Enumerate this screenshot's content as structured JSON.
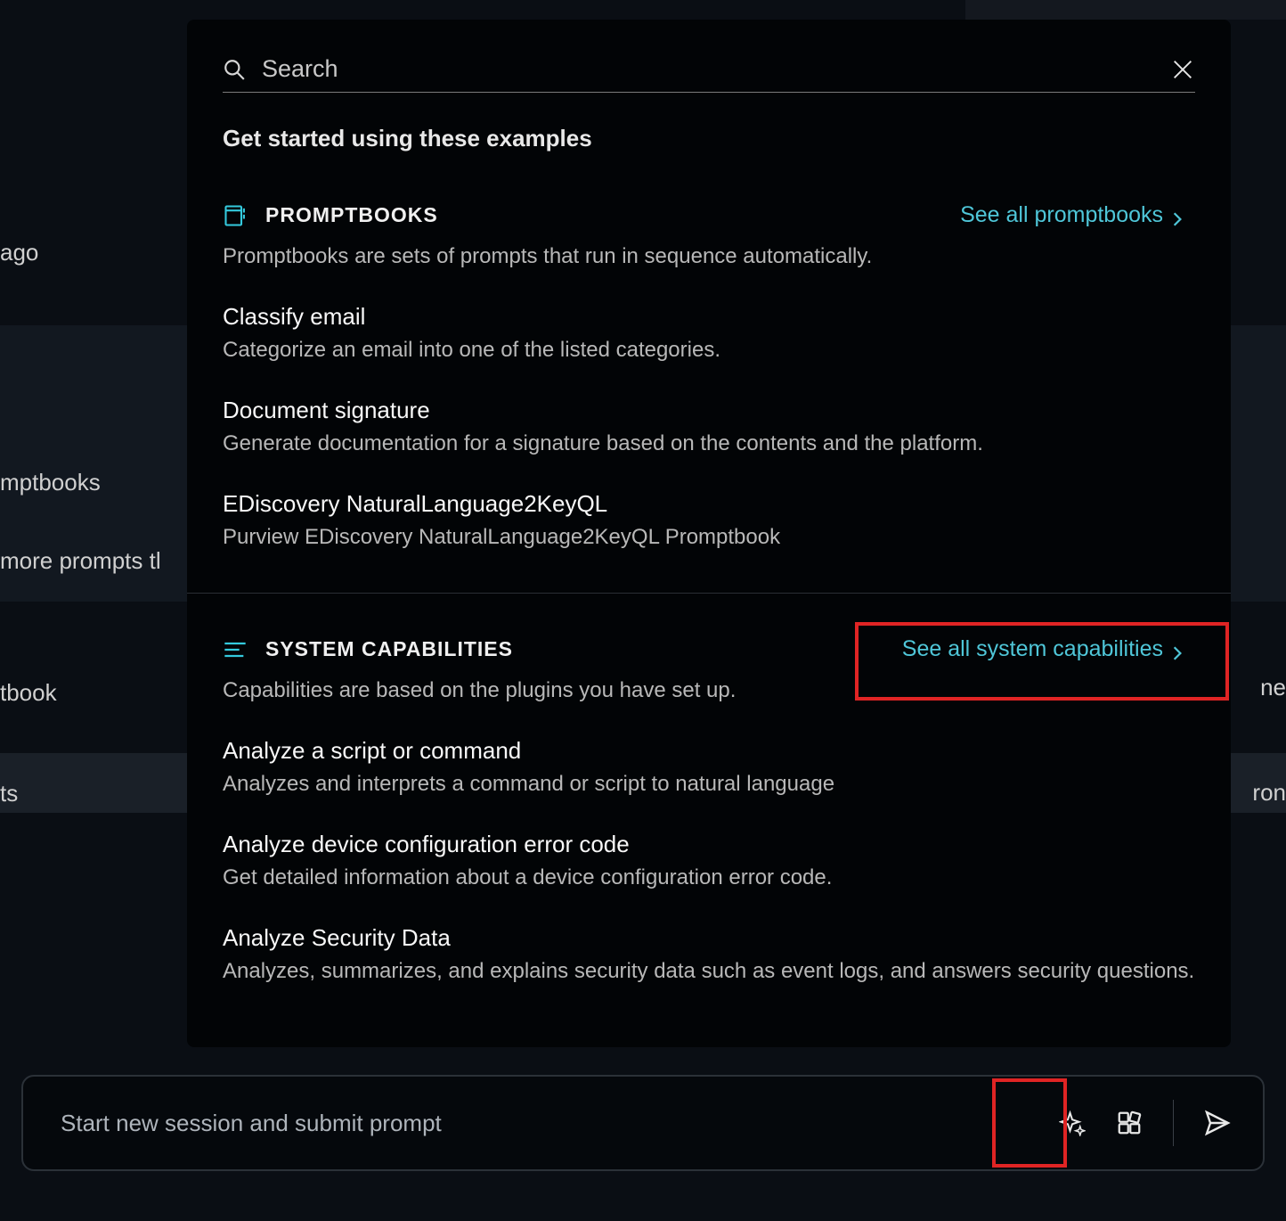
{
  "background": {
    "ago": "ago",
    "mptbooks": "mptbooks",
    "moreprompts": " more prompts tl",
    "tbook": "tbook",
    "ts": "ts",
    "ne": "ne",
    "ron": "ron"
  },
  "popup": {
    "search_placeholder": "Search",
    "get_started": "Get started using these examples",
    "promptbooks": {
      "header": "PROMPTBOOKS",
      "see_all": "See all promptbooks",
      "description": "Promptbooks are sets of prompts that run in sequence automatically.",
      "items": [
        {
          "title": "Classify email",
          "desc": "Categorize an email into one of the listed categories."
        },
        {
          "title": "Document signature",
          "desc": "Generate documentation for a signature based on the contents and the platform."
        },
        {
          "title": "EDiscovery NaturalLanguage2KeyQL",
          "desc": "Purview EDiscovery NaturalLanguage2KeyQL Promptbook"
        }
      ]
    },
    "capabilities": {
      "header": "SYSTEM CAPABILITIES",
      "see_all": "See all system capabilities",
      "description": "Capabilities are based on the plugins you have set up.",
      "items": [
        {
          "title": "Analyze a script or command",
          "desc": "Analyzes and interprets a command or script to natural language"
        },
        {
          "title": "Analyze device configuration error code",
          "desc": "Get detailed information about a device configuration error code."
        },
        {
          "title": "Analyze Security Data",
          "desc": "Analyzes, summarizes, and explains security data such as event logs, and answers security questions."
        }
      ]
    }
  },
  "promptbar": {
    "placeholder": "Start new session and submit prompt"
  }
}
